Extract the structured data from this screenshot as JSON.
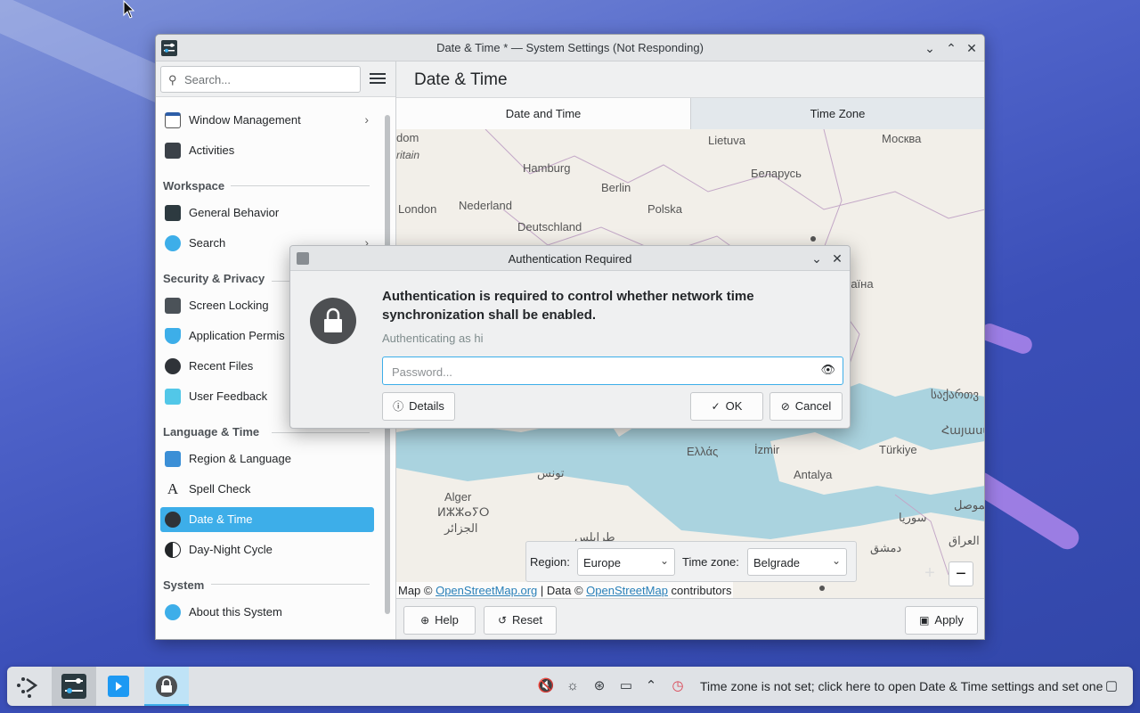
{
  "window": {
    "title": "Date & Time * — System Settings (Not Responding)",
    "page_title": "Date & Time"
  },
  "sidebar": {
    "search_placeholder": "Search...",
    "items": [
      {
        "label": "Window Management",
        "icon": "window-management-icon",
        "chevron": "›"
      },
      {
        "label": "Activities",
        "icon": "activities-icon"
      },
      {
        "label": "General Behavior",
        "icon": "general-behavior-icon"
      },
      {
        "label": "Search",
        "icon": "search-settings-icon",
        "chevron": "›"
      },
      {
        "label": "Screen Locking",
        "icon": "screen-locking-icon"
      },
      {
        "label": "Application Permis",
        "icon": "application-permissions-icon"
      },
      {
        "label": "Recent Files",
        "icon": "recent-files-icon"
      },
      {
        "label": "User Feedback",
        "icon": "user-feedback-icon"
      },
      {
        "label": "Region & Language",
        "icon": "region-language-icon"
      },
      {
        "label": "Spell Check",
        "icon": "spell-check-icon"
      },
      {
        "label": "Date & Time",
        "icon": "date-time-icon",
        "active": true
      },
      {
        "label": "Day-Night Cycle",
        "icon": "day-night-cycle-icon"
      },
      {
        "label": "About this System",
        "icon": "about-system-icon"
      }
    ],
    "sections": {
      "workspace": "Workspace",
      "security": "Security & Privacy",
      "language": "Language & Time",
      "system": "System"
    }
  },
  "tabs": [
    "Date and Time",
    "Time Zone"
  ],
  "map": {
    "labels": [
      "dom",
      "ritain",
      "Lietuva",
      "Москва",
      "Hamburg",
      "Berlin",
      "Беларусь",
      "London",
      "Nederland",
      "Polska",
      "Deutschland",
      "raїна",
      "საქართვ",
      "Հայաստ",
      "Ελλάς",
      "İzmir",
      "Türkiye",
      "Antalya",
      "تونس",
      "Alger",
      "ⵍⵣⵣⴰⵢⵔ",
      "الجزائر",
      "سوريا",
      "الموصل",
      "العراق",
      "دمشق",
      "طرابلس"
    ],
    "attribution_prefix": "Map © ",
    "attribution_osm": "OpenStreetMap.org",
    "attribution_mid": " | Data © ",
    "attribution_osm2": "OpenStreetMap",
    "attribution_suffix": " contributors",
    "zoom_in": "+",
    "zoom_out": "−"
  },
  "timezone": {
    "region_label": "Region:",
    "region_value": "Europe",
    "zone_label": "Time zone:",
    "zone_value": "Belgrade"
  },
  "footer": {
    "help": "Help",
    "reset": "Reset",
    "apply": "Apply"
  },
  "dialog": {
    "title": "Authentication Required",
    "message": "Authentication is required to control whether network time synchronization shall be enabled.",
    "sub": "Authenticating as hi",
    "password_placeholder": "Password...",
    "details": "Details",
    "ok": "OK",
    "cancel": "Cancel"
  },
  "taskbar": {
    "notice": "Time zone is not set; click here to open Date & Time settings and set one"
  },
  "colors": {
    "accent": "#3daee9",
    "map_water": "#aad3df",
    "map_land": "#f2efe9"
  }
}
